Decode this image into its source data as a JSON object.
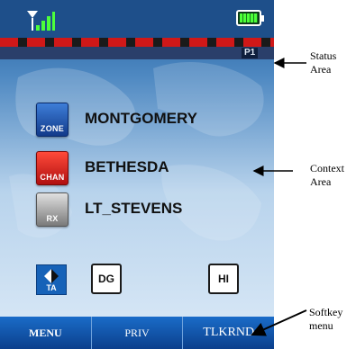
{
  "status": {
    "profile_tag": "P1"
  },
  "context": {
    "rows": [
      {
        "badge": "ZONE",
        "value": "MONTGOMERY"
      },
      {
        "badge": "CHAN",
        "value": "BETHESDA"
      },
      {
        "badge": "RX",
        "value": "LT_STEVENS"
      }
    ]
  },
  "indicators": {
    "ta_label": "TA",
    "dg_label": "DG",
    "hi_label": "HI"
  },
  "softkeys": [
    "MENU",
    "PRIV",
    "TLKRND"
  ],
  "annotations": {
    "status_area": [
      "Status",
      "Area"
    ],
    "context_area": [
      "Context",
      "Area"
    ],
    "softkey_menu": [
      "Softkey",
      "menu"
    ]
  },
  "colors": {
    "zone_badge": "#1f5fc4",
    "chan_badge": "#d82a1e",
    "rx_badge": "#a0a0a0",
    "softkey_bar": "#1556a8",
    "top_bar": "#1e4f8a"
  },
  "icons": [
    "signal-strength-icon",
    "battery-icon",
    "ta-icon"
  ]
}
